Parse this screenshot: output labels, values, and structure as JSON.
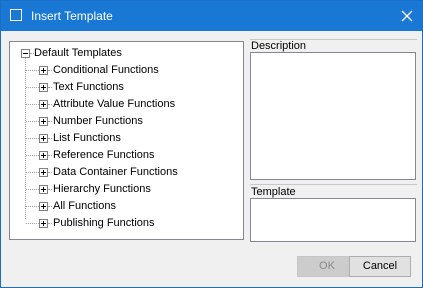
{
  "window": {
    "title": "Insert Template"
  },
  "tree": {
    "root_label": "Default Templates",
    "items": [
      {
        "label": "Conditional Functions"
      },
      {
        "label": "Text Functions"
      },
      {
        "label": "Attribute Value Functions"
      },
      {
        "label": "Number Functions"
      },
      {
        "label": "List Functions"
      },
      {
        "label": "Reference Functions"
      },
      {
        "label": "Data Container Functions"
      },
      {
        "label": "Hierarchy Functions"
      },
      {
        "label": "All Functions"
      },
      {
        "label": "Publishing Functions"
      }
    ]
  },
  "description": {
    "label": "Description",
    "value": ""
  },
  "template": {
    "label": "Template",
    "value": ""
  },
  "buttons": {
    "ok": "OK",
    "cancel": "Cancel"
  },
  "colors": {
    "titlebar": "#1878d4",
    "dialog_bg": "#f0f0f0"
  },
  "icons": {
    "close": "close-icon",
    "app": "window-icon"
  }
}
